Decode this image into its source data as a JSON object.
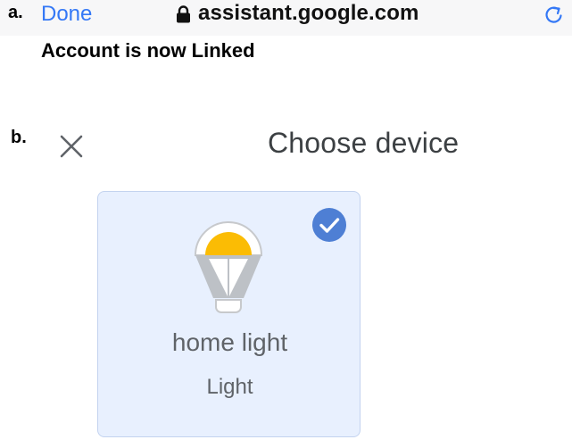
{
  "panel_a": {
    "label": "a.",
    "done_label": "Done",
    "url": "assistant.google.com",
    "message": "Account is now Linked",
    "colors": {
      "link": "#3478f6",
      "bar_background": "#f7f7f8"
    }
  },
  "panel_b": {
    "label": "b.",
    "title": "Choose device",
    "device": {
      "name": "home light",
      "type": "Light",
      "selected": true
    },
    "colors": {
      "card_background": "#e8f0fe",
      "check": "#4e7fd4",
      "bulb_glow": "#fbbc04"
    }
  }
}
